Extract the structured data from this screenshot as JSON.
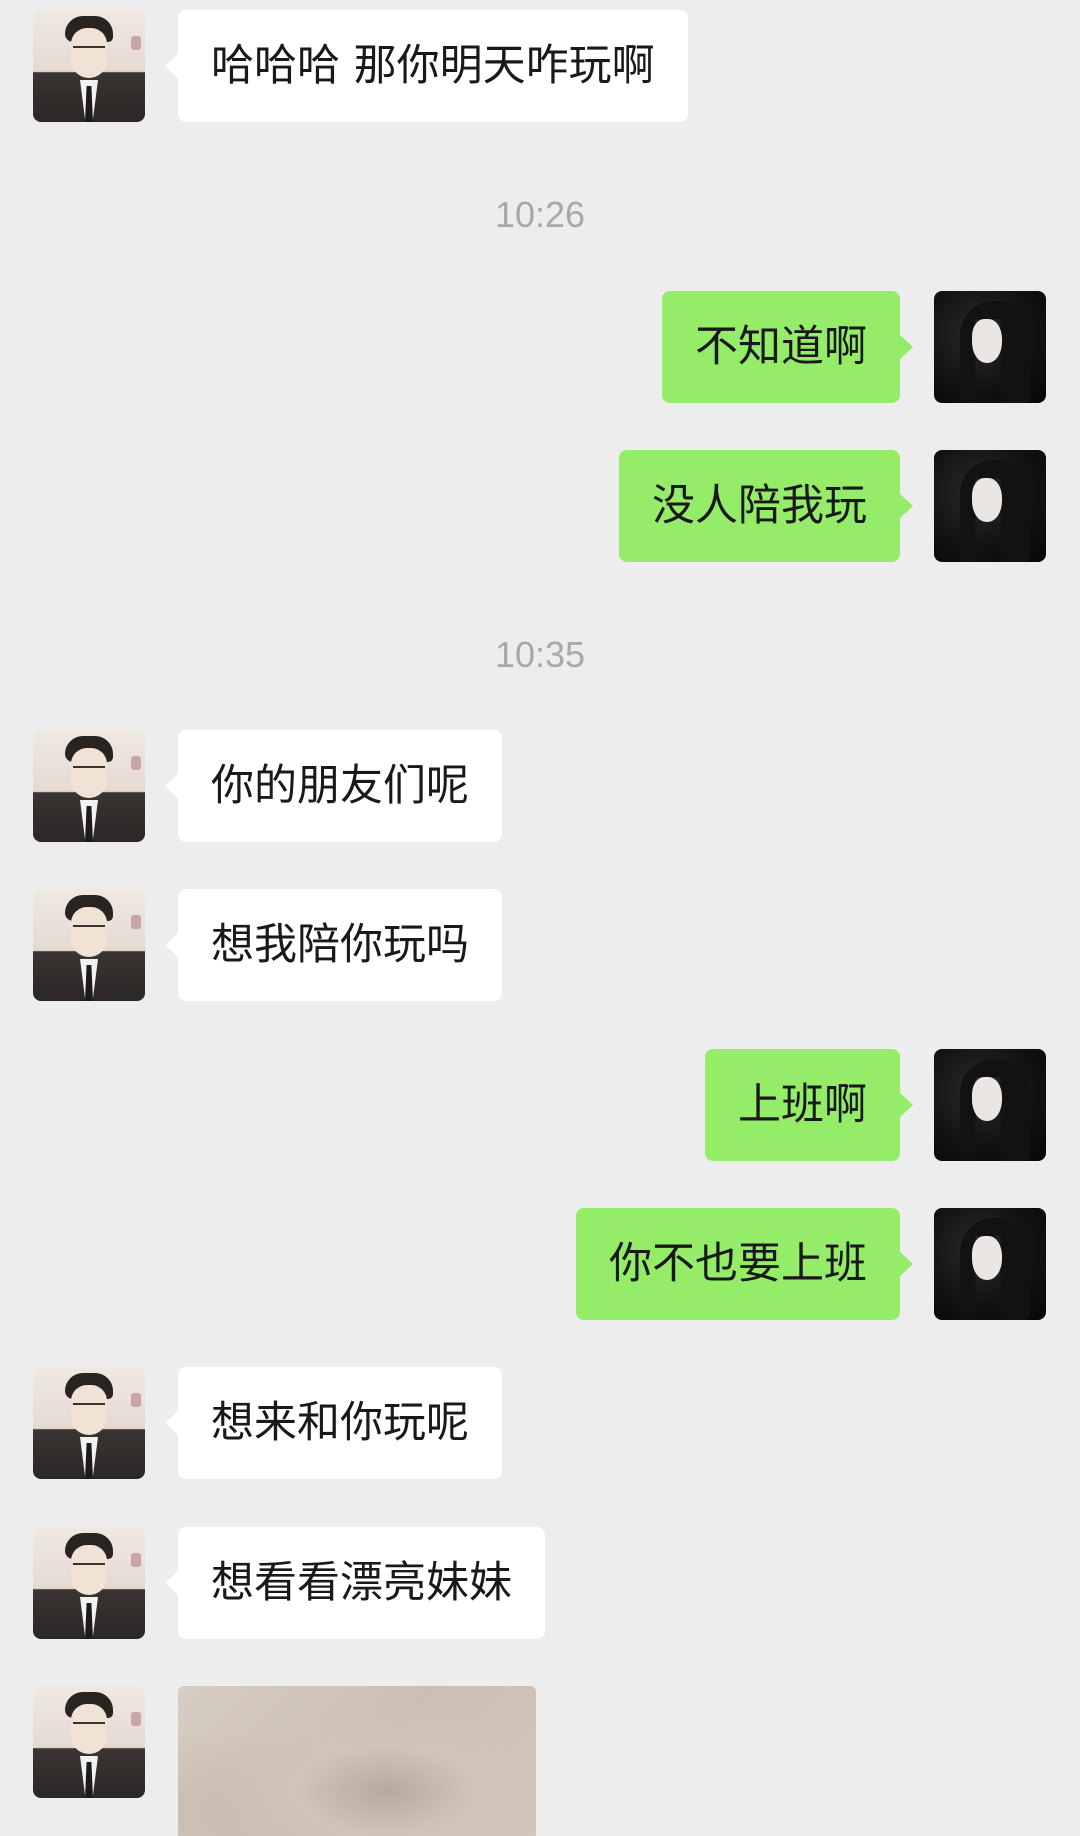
{
  "chat": {
    "timestamps": [
      "10:26",
      "10:35"
    ],
    "messages": [
      {
        "side": "left",
        "text": "哈哈哈 那你明天咋玩啊"
      },
      {
        "side": "right",
        "text": "不知道啊"
      },
      {
        "side": "right",
        "text": "没人陪我玩"
      },
      {
        "side": "left",
        "text": "你的朋友们呢"
      },
      {
        "side": "left",
        "text": "想我陪你玩吗"
      },
      {
        "side": "right",
        "text": "上班啊"
      },
      {
        "side": "right",
        "text": "你不也要上班"
      },
      {
        "side": "left",
        "text": "想来和你玩呢"
      },
      {
        "side": "left",
        "text": "想看看漂亮妹妹"
      }
    ]
  }
}
